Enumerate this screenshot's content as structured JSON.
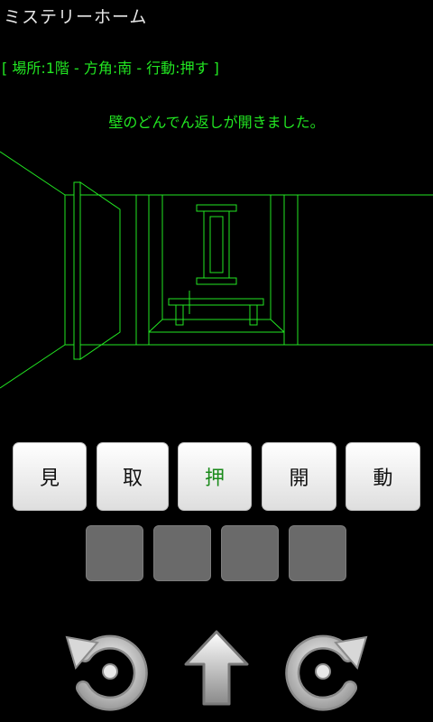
{
  "app": {
    "title": "ミステリーホーム"
  },
  "status": {
    "text": "[ 場所:1階 - 方角:南 - 行動:押す ]"
  },
  "message": {
    "text": "壁のどんでん返しが開きました。"
  },
  "colors": {
    "wireframe": "#22e622",
    "status_text": "#22e622",
    "active_command": "#1a8a1a",
    "slot": "#6a6a6a"
  },
  "commands": [
    {
      "label": "見",
      "active": false
    },
    {
      "label": "取",
      "active": false
    },
    {
      "label": "押",
      "active": true
    },
    {
      "label": "開",
      "active": false
    },
    {
      "label": "動",
      "active": false
    }
  ],
  "inventory_slots": 4,
  "navigation": {
    "left": "rotate-left-icon",
    "forward": "arrow-up-icon",
    "right": "rotate-right-icon"
  }
}
